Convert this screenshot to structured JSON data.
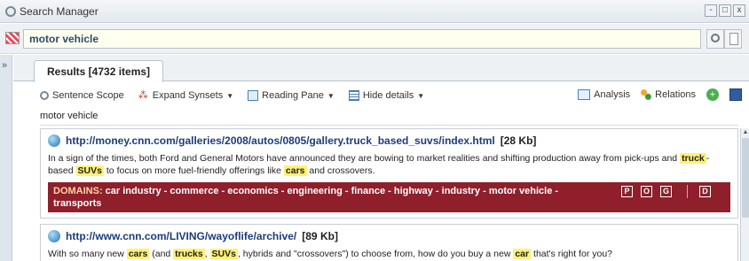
{
  "window": {
    "title": "Search Manager",
    "minimize": "-",
    "restore": "□",
    "close": "x"
  },
  "search": {
    "value": "motor vehicle"
  },
  "tab": {
    "label": "Results [4732 items]"
  },
  "sidebar": {
    "toggle": "»"
  },
  "toolbar": {
    "sentence_scope": "Sentence Scope",
    "expand_synsets": "Expand Synsets",
    "reading_pane": "Reading Pane",
    "hide_details": "Hide details",
    "analysis": "Analysis",
    "relations": "Relations"
  },
  "query_line": "motor vehicle",
  "results": [
    {
      "url": "http://money.cnn.com/galleries/2008/autos/0805/gallery.truck_based_suvs/index.html",
      "size": "[28 Kb]",
      "snippet": {
        "a": "In a sign of the times, both Ford and General Motors have announced they are bowing to market realities and shifting production away from pick-ups and",
        "b": "truck",
        "c": "-based",
        "d": "SUVs",
        "e": "to focus on more fuel-friendly offerings like",
        "f": "cars",
        "g": "and crossovers."
      },
      "domains_label": "DOMAINS:",
      "domains_text": "car industry - commerce - economics - engineering - finance - highway - industry - motor vehicle - transports",
      "domain_buttons": [
        "P",
        "O",
        "G",
        "D"
      ]
    },
    {
      "url": "http://www.cnn.com/LIVING/wayoflife/archive/",
      "size": "[89 Kb]",
      "snippet": {
        "a": "With so many new",
        "b": "cars",
        "c": "(and",
        "d": "trucks",
        "e": ",",
        "f": "SUVs",
        "g": ", hybrids and \"crossovers\") to choose from, how do you buy a new",
        "h": "car",
        "i": "that's right for you?"
      }
    }
  ]
}
